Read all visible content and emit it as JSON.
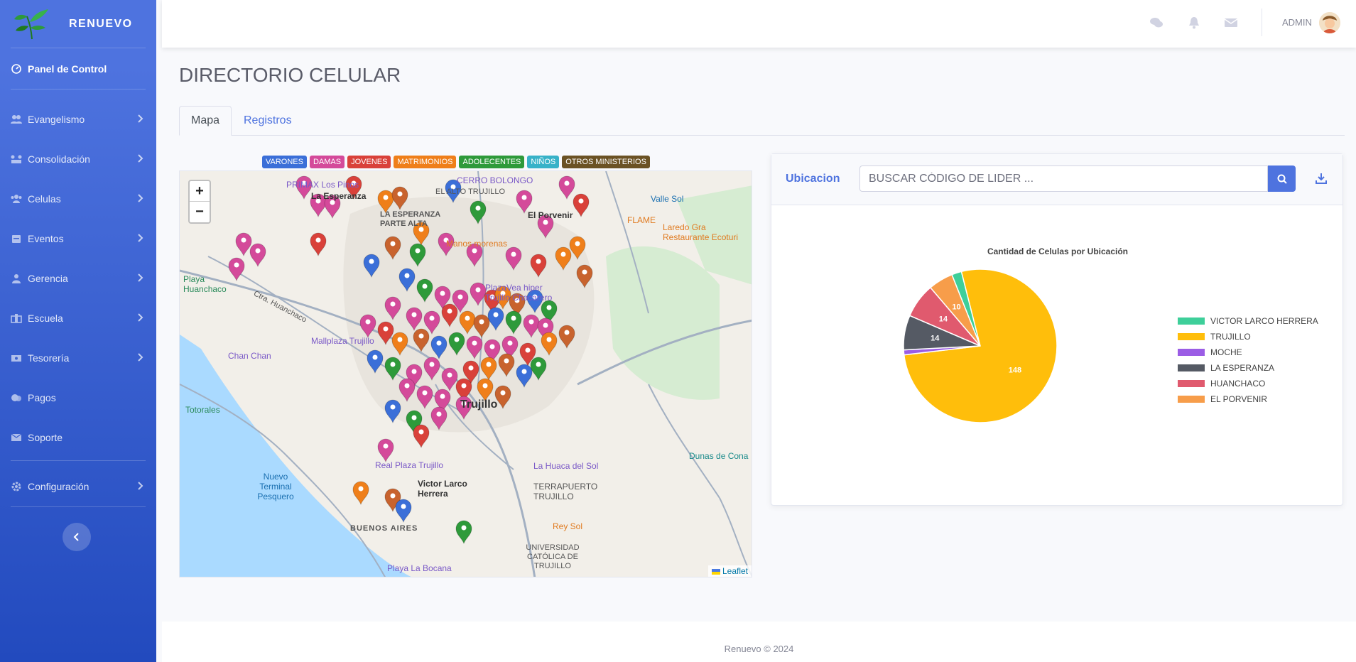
{
  "brand": {
    "name": "RENUEVO"
  },
  "sidebar": {
    "active_item": {
      "label": "Panel de Control",
      "icon": "dashboard-icon"
    },
    "items": [
      {
        "label": "Evangelismo",
        "icon": "users-icon"
      },
      {
        "label": "Consolidación",
        "icon": "link-icon"
      },
      {
        "label": "Celulas",
        "icon": "group-icon"
      },
      {
        "label": "Eventos",
        "icon": "calendar-icon"
      },
      {
        "label": "Gerencia",
        "icon": "user-tie-icon"
      },
      {
        "label": "Escuela",
        "icon": "school-icon"
      },
      {
        "label": "Tesorería",
        "icon": "money-icon"
      },
      {
        "label": "Pagos",
        "icon": "wallet-icon"
      },
      {
        "label": "Soporte",
        "icon": "envelope-icon"
      }
    ],
    "config": {
      "label": "Configuración",
      "icon": "gear-icon"
    }
  },
  "topbar": {
    "user": "ADMIN"
  },
  "page": {
    "title": "DIRECTORIO CELULAR",
    "tabs": [
      "Mapa",
      "Registros"
    ]
  },
  "legend_badges": [
    {
      "label": "VARONES",
      "color": "#3b6fd8"
    },
    {
      "label": "DAMAS",
      "color": "#d44a9a"
    },
    {
      "label": "JOVENES",
      "color": "#d9413a"
    },
    {
      "label": "MATRIMONIOS",
      "color": "#ef7f1a"
    },
    {
      "label": "ADOLECENTES",
      "color": "#2e9a3a"
    },
    {
      "label": "NIÑOS",
      "color": "#38b2c8"
    },
    {
      "label": "OTROS MINISTERIOS",
      "color": "#6b5224"
    }
  ],
  "map": {
    "labels": [
      "La Esperanza",
      "LA ESPERANZA PARTE ALTA",
      "El Porvenir",
      "FLAME",
      "Laredo Gra Restaurante Ecoturi",
      "Manos morenas",
      "PlazaVea hiper Trujillo Chacarero",
      "Playa Huanchaco",
      "Ctra. Huanchaco",
      "Mallplaza Trujillo",
      "Chan Chan",
      "Totorales",
      "Nuevo Terminal Pesquero",
      "BUENOS AIRES",
      "Real Plaza Trujillo",
      "Victor Larco Herrera",
      "La Huaca del Sol",
      "TERRAPUERTO TRUJILLO",
      "Rey Sol",
      "UNIVERSIDAD CATÓLICA DE TRUJILLO",
      "Playa La Bocana",
      "Dunas de Cona",
      "PRIMAX Los Pinos",
      "CERRO BOLONGO",
      "Valle Sol",
      "EL ALTO TRUJILLO",
      "Trujillo"
    ],
    "zoom_in": "+",
    "zoom_out": "−",
    "attribution": "Leaflet"
  },
  "card": {
    "label": "Ubicacion",
    "search_placeholder": "BUSCAR CÓDIGO DE LIDER ..."
  },
  "chart_data": {
    "type": "pie",
    "title": "Cantidad de Celulas por Ubicación",
    "categories": [
      "VICTOR LARCO HERRERA",
      "TRUJILLO",
      "MOCHE",
      "LA ESPERANZA",
      "HUANCHACO",
      "EL PORVENIR"
    ],
    "values": [
      4,
      148,
      2,
      14,
      14,
      10
    ],
    "data_labels": [
      "",
      "148",
      "",
      "14",
      "14",
      "10"
    ],
    "colors": [
      "#3ecf9a",
      "#ffbe0b",
      "#9b5de5",
      "#555a64",
      "#e05a6e",
      "#f79d4a"
    ],
    "legend": "right"
  },
  "footer": {
    "text": "Renuevo © 2024"
  }
}
